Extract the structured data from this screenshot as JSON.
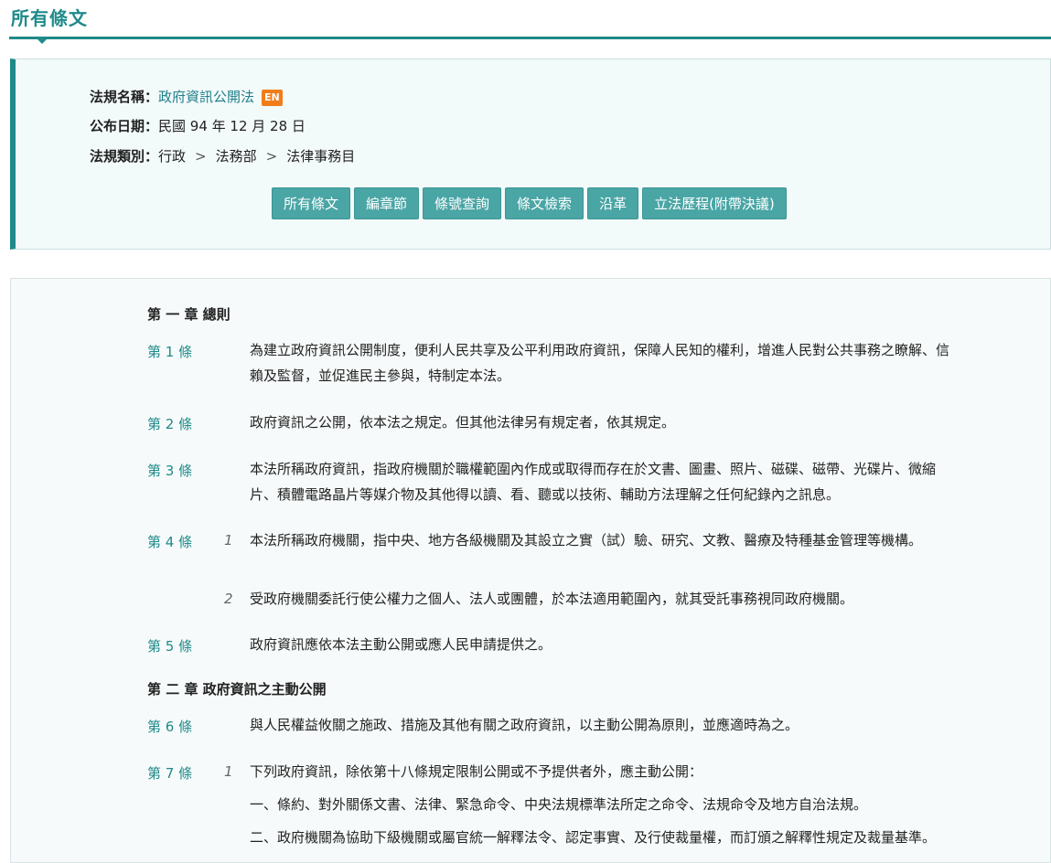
{
  "page": {
    "title": "所有條文"
  },
  "law": {
    "name_label": "法規名稱：",
    "name": "政府資訊公開法",
    "en_badge": "EN",
    "date_label": "公布日期：",
    "date": "民國 94 年 12 月 28 日",
    "category_label": "法規類別：",
    "category": [
      "行政",
      "法務部",
      "法律事務目"
    ],
    "category_sep": ">"
  },
  "tabs": [
    "所有條文",
    "編章節",
    "條號查詢",
    "條文檢索",
    "沿革",
    "立法歷程(附帶決議)"
  ],
  "chapters": [
    {
      "label": "第 一 章 總則"
    },
    {
      "label": "第 二 章 政府資訊之主動公開"
    }
  ],
  "articles": [
    {
      "no": "第 1 條",
      "paras": [
        {
          "num": "",
          "text": "為建立政府資訊公開制度，便利人民共享及公平利用政府資訊，保障人民知的權利，增進人民對公共事務之瞭解、信賴及監督，並促進民主參與，特制定本法。"
        }
      ]
    },
    {
      "no": "第 2 條",
      "paras": [
        {
          "num": "",
          "text": "政府資訊之公開，依本法之規定。但其他法律另有規定者，依其規定。"
        }
      ]
    },
    {
      "no": "第 3 條",
      "paras": [
        {
          "num": "",
          "text": "本法所稱政府資訊，指政府機關於職權範圍內作成或取得而存在於文書、圖畫、照片、磁碟、磁帶、光碟片、微縮片、積體電路晶片等媒介物及其他得以讀、看、聽或以技術、輔助方法理解之任何紀錄內之訊息。"
        }
      ]
    },
    {
      "no": "第 4 條",
      "paras": [
        {
          "num": "1",
          "text": "本法所稱政府機關，指中央、地方各級機關及其設立之實（試）驗、研究、文教、醫療及特種基金管理等機構。"
        },
        {
          "num": "2",
          "text": "受政府機關委託行使公權力之個人、法人或團體，於本法適用範圍內，就其受託事務視同政府機關。"
        }
      ]
    },
    {
      "no": "第 5 條",
      "paras": [
        {
          "num": "",
          "text": "政府資訊應依本法主動公開或應人民申請提供之。"
        }
      ]
    },
    {
      "no": "第 6 條",
      "paras": [
        {
          "num": "",
          "text": "與人民權益攸關之施政、措施及其他有關之政府資訊，以主動公開為原則，並應適時為之。"
        }
      ]
    },
    {
      "no": "第 7 條",
      "paras": [
        {
          "num": "1",
          "text": "下列政府資訊，除依第十八條規定限制公開或不予提供者外，應主動公開："
        },
        {
          "num": "",
          "text": "一、條約、對外關係文書、法律、緊急命令、中央法規標準法所定之命令、法規命令及地方自治法規。"
        },
        {
          "num": "",
          "text": "二、政府機關為協助下級機關或屬官統一解釋法令、認定事實、及行使裁量權，而訂頒之解釋性規定及裁量基準。"
        }
      ]
    }
  ]
}
